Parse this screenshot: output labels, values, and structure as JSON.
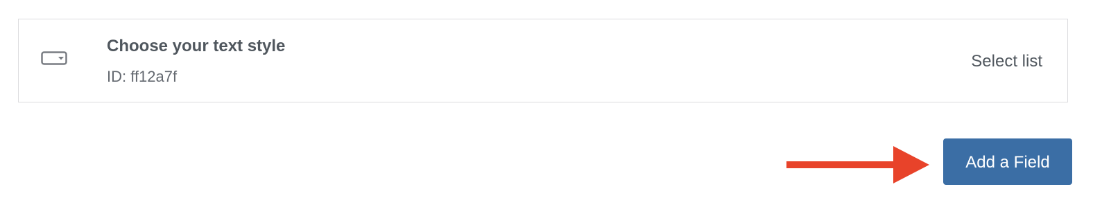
{
  "field": {
    "title": "Choose your text style",
    "id_label": "ID: ff12a7f",
    "type_label": "Select list",
    "icon": "select-dropdown-icon"
  },
  "actions": {
    "add_field_label": "Add a Field"
  },
  "annotation": {
    "icon": "arrow-right-icon",
    "color": "#e8432a"
  },
  "colors": {
    "button_bg": "#3b6ea5",
    "border": "#dcdcde",
    "text": "#50575e"
  }
}
